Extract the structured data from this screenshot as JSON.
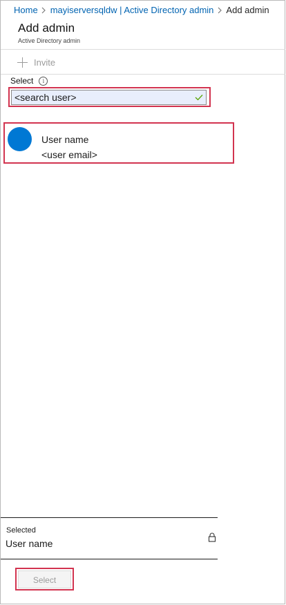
{
  "breadcrumb": {
    "home": "Home",
    "server": "mayiserversqldw | Active Directory admin",
    "current": "Add admin"
  },
  "header": {
    "title": "Add admin",
    "subtitle": "Active Directory admin"
  },
  "toolbar": {
    "invite_label": "Invite",
    "invite_icon": "plus-icon"
  },
  "select": {
    "label": "Select",
    "info_icon": "info-icon",
    "search_value": "<search user>",
    "valid_icon": "checkmark-icon"
  },
  "results": [
    {
      "name": "User name",
      "email": "<user email>",
      "avatar_color": "#0078d4"
    }
  ],
  "selected": {
    "heading": "Selected",
    "value": "User name",
    "lock_icon": "lock-icon"
  },
  "footer": {
    "select_button_label": "Select"
  },
  "colors": {
    "link": "#0063b1",
    "highlight": "#d2334f",
    "avatar": "#0078d4",
    "search_bg": "#e8eefc",
    "valid_check": "#57a300"
  }
}
